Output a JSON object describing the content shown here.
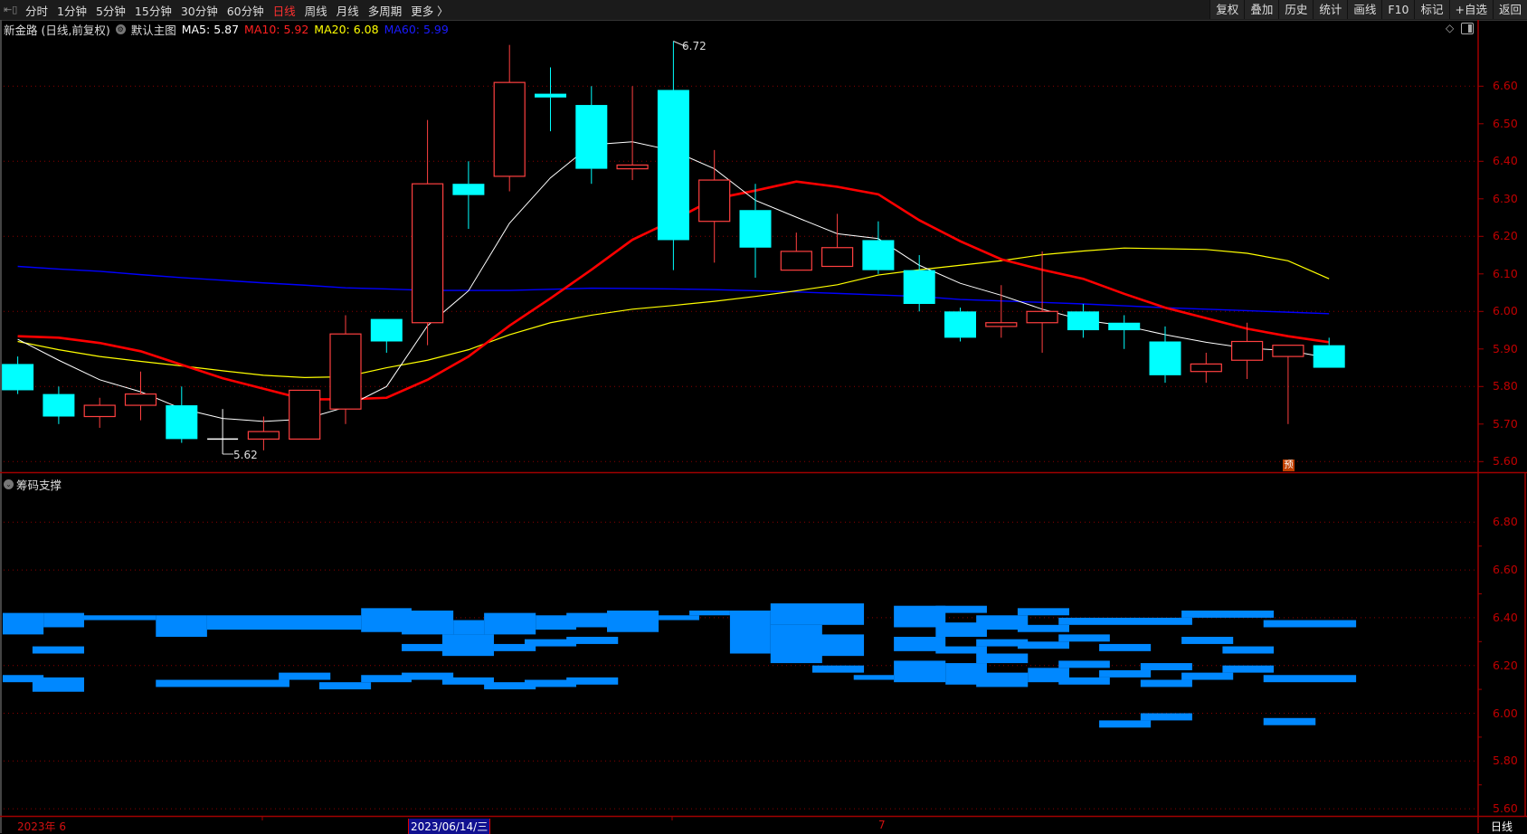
{
  "toolbar": {
    "periods": [
      "分时",
      "1分钟",
      "5分钟",
      "15分钟",
      "30分钟",
      "60分钟",
      "日线",
      "周线",
      "月线",
      "多周期",
      "更多 〉"
    ],
    "active_period": "日线",
    "buttons": [
      "复权",
      "叠加",
      "历史",
      "统计",
      "画线",
      "F10",
      "标记",
      "+自选",
      "返回"
    ]
  },
  "info": {
    "title": "新金路 (日线,前复权)",
    "template": "默认主图",
    "ma5": "MA5: 5.87",
    "ma10": "MA10: 5.92",
    "ma20": "MA20: 6.08",
    "ma60": "MA60: 5.99"
  },
  "colors": {
    "up": "#ff4040",
    "down": "#00ffff",
    "doji": "#ffffff",
    "ma5": "#ffffff",
    "ma10": "#ff0000",
    "ma20": "#ffff00",
    "ma60": "#0000ff",
    "chip": "#0088ff",
    "grid": "#8b0000"
  },
  "lower_panel": {
    "title": "筹码支撑"
  },
  "annotations": {
    "high": "6.72",
    "low": "5.62",
    "forecast_marker": "预"
  },
  "axis": {
    "main_ticks": [
      "6.60",
      "6.50",
      "6.40",
      "6.30",
      "6.20",
      "6.10",
      "6.00",
      "5.90",
      "5.80",
      "5.70",
      "5.60"
    ],
    "lower_ticks": [
      "6.80",
      "6.60",
      "6.40",
      "6.20",
      "6.00",
      "5.80",
      "5.60"
    ],
    "x_labels": {
      "start": "2023年 6",
      "cursor": "2023/06/14/三",
      "july": "7"
    },
    "period_label": "日线"
  },
  "chart_data": [
    {
      "type": "candlestick",
      "title": "新金路 (日线,前复权)",
      "ylim": [
        5.6,
        6.6
      ],
      "ohlc": [
        [
          5.86,
          5.88,
          5.78,
          5.79
        ],
        [
          5.78,
          5.8,
          5.7,
          5.72
        ],
        [
          5.72,
          5.77,
          5.69,
          5.75
        ],
        [
          5.75,
          5.84,
          5.71,
          5.78
        ],
        [
          5.75,
          5.8,
          5.65,
          5.66
        ],
        [
          5.66,
          5.74,
          5.62,
          5.66
        ],
        [
          5.66,
          5.72,
          5.63,
          5.68
        ],
        [
          5.66,
          5.79,
          5.66,
          5.79
        ],
        [
          5.74,
          5.99,
          5.7,
          5.94
        ],
        [
          5.98,
          5.98,
          5.89,
          5.92
        ],
        [
          5.97,
          6.51,
          5.91,
          6.34
        ],
        [
          6.34,
          6.4,
          6.22,
          6.31
        ],
        [
          6.36,
          6.71,
          6.32,
          6.61
        ],
        [
          6.58,
          6.65,
          6.48,
          6.57
        ],
        [
          6.55,
          6.6,
          6.34,
          6.38
        ],
        [
          6.38,
          6.6,
          6.35,
          6.39
        ],
        [
          6.59,
          6.72,
          6.11,
          6.19
        ],
        [
          6.24,
          6.43,
          6.13,
          6.35
        ],
        [
          6.27,
          6.34,
          6.09,
          6.17
        ],
        [
          6.11,
          6.21,
          6.11,
          6.16
        ],
        [
          6.12,
          6.26,
          6.12,
          6.17
        ],
        [
          6.19,
          6.24,
          6.1,
          6.11
        ],
        [
          6.11,
          6.15,
          6.0,
          6.02
        ],
        [
          6.0,
          6.01,
          5.92,
          5.93
        ],
        [
          5.96,
          6.07,
          5.93,
          5.97
        ],
        [
          5.97,
          6.16,
          5.89,
          6.0
        ],
        [
          6.0,
          6.02,
          5.93,
          5.95
        ],
        [
          5.97,
          5.99,
          5.9,
          5.95
        ],
        [
          5.92,
          5.96,
          5.81,
          5.83
        ],
        [
          5.84,
          5.89,
          5.81,
          5.86
        ],
        [
          5.87,
          5.97,
          5.82,
          5.92
        ],
        [
          5.88,
          5.91,
          5.7,
          5.91
        ],
        [
          5.91,
          5.93,
          5.85,
          5.85
        ]
      ],
      "series": [
        {
          "name": "MA5",
          "values": [
            5.926,
            5.87,
            5.818,
            5.786,
            5.741,
            5.715,
            5.707,
            5.713,
            5.745,
            5.8,
            5.962,
            6.055,
            6.235,
            6.356,
            6.444,
            6.452,
            6.428,
            6.38,
            6.296,
            6.251,
            6.207,
            6.194,
            6.123,
            6.075,
            6.043,
            6.006,
            5.977,
            5.962,
            5.938,
            5.918,
            5.902,
            5.896,
            5.876
          ]
        },
        {
          "name": "MA10",
          "values": [
            5.934,
            5.93,
            5.916,
            5.894,
            5.858,
            5.822,
            5.794,
            5.766,
            5.766,
            5.77,
            5.818,
            5.88,
            5.962,
            6.035,
            6.111,
            6.191,
            6.243,
            6.3,
            6.322,
            6.346,
            6.332,
            6.312,
            6.243,
            6.187,
            6.139,
            6.111,
            6.087,
            6.047,
            6.01,
            5.982,
            5.954,
            5.934,
            5.918
          ]
        },
        {
          "name": "MA20",
          "values": [
            5.92,
            5.898,
            5.88,
            5.867,
            5.855,
            5.842,
            5.83,
            5.824,
            5.826,
            5.85,
            5.87,
            5.898,
            5.938,
            5.97,
            5.99,
            6.006,
            6.016,
            6.027,
            6.04,
            6.055,
            6.071,
            6.097,
            6.111,
            6.123,
            6.135,
            6.151,
            6.161,
            6.169,
            6.167,
            6.165,
            6.155,
            6.135,
            6.087
          ]
        },
        {
          "name": "MA60",
          "values": [
            6.12,
            6.113,
            6.107,
            6.098,
            6.09,
            6.083,
            6.076,
            6.07,
            6.063,
            6.06,
            6.056,
            6.056,
            6.056,
            6.059,
            6.062,
            6.061,
            6.06,
            6.058,
            6.055,
            6.052,
            6.048,
            6.044,
            6.04,
            6.032,
            6.028,
            6.024,
            6.02,
            6.015,
            6.01,
            6.006,
            6.002,
            5.998,
            5.994
          ]
        }
      ]
    },
    {
      "type": "chip_distribution",
      "title": "筹码支撑",
      "ylim": [
        5.6,
        6.8
      ],
      "bars_note": "each bar: [from candle index, to candle index, price top, price bottom]",
      "bars": [
        [
          -0.4,
          0.63,
          6.42,
          6.33
        ],
        [
          0.63,
          1.62,
          6.42,
          6.36
        ],
        [
          1.62,
          3.37,
          6.41,
          6.39
        ],
        [
          3.37,
          4.62,
          6.41,
          6.32
        ],
        [
          4.62,
          8.38,
          6.41,
          6.35
        ],
        [
          8.38,
          9.61,
          6.44,
          6.34
        ],
        [
          9.37,
          10.63,
          6.43,
          6.33
        ],
        [
          10.63,
          11.38,
          6.39,
          6.33
        ],
        [
          11.38,
          12.64,
          6.42,
          6.33
        ],
        [
          12.64,
          13.63,
          6.41,
          6.35
        ],
        [
          13.39,
          14.38,
          6.42,
          6.36
        ],
        [
          14.38,
          15.64,
          6.43,
          6.34
        ],
        [
          0.36,
          1.62,
          6.28,
          6.25
        ],
        [
          9.37,
          10.63,
          6.29,
          6.26
        ],
        [
          10.36,
          11.62,
          6.33,
          6.24
        ],
        [
          11.62,
          12.64,
          6.29,
          6.26
        ],
        [
          12.37,
          13.63,
          6.31,
          6.28
        ],
        [
          13.39,
          14.65,
          6.32,
          6.29
        ],
        [
          -0.4,
          0.63,
          6.16,
          6.13
        ],
        [
          0.36,
          1.62,
          6.15,
          6.09
        ],
        [
          3.37,
          6.63,
          6.14,
          6.11
        ],
        [
          6.37,
          7.63,
          6.17,
          6.14
        ],
        [
          7.36,
          8.62,
          6.13,
          6.1
        ],
        [
          8.38,
          9.61,
          6.16,
          6.13
        ],
        [
          9.37,
          10.63,
          6.17,
          6.14
        ],
        [
          10.36,
          11.62,
          6.15,
          6.12
        ],
        [
          11.38,
          12.64,
          6.13,
          6.1
        ],
        [
          12.37,
          13.63,
          6.14,
          6.11
        ],
        [
          13.39,
          14.65,
          6.15,
          6.12
        ],
        [
          15.64,
          16.63,
          6.41,
          6.39
        ],
        [
          16.39,
          17.38,
          6.43,
          6.41
        ],
        [
          17.38,
          18.37,
          6.43,
          6.25
        ],
        [
          18.37,
          20.65,
          6.46,
          6.37
        ],
        [
          18.37,
          19.63,
          6.37,
          6.21
        ],
        [
          18.64,
          20.65,
          6.33,
          6.24
        ],
        [
          19.39,
          20.65,
          6.2,
          6.17
        ],
        [
          20.4,
          21.38,
          6.16,
          6.14
        ],
        [
          21.38,
          22.64,
          6.45,
          6.36
        ],
        [
          21.38,
          22.64,
          6.32,
          6.26
        ],
        [
          21.38,
          22.64,
          6.22,
          6.13
        ],
        [
          22.4,
          23.65,
          6.45,
          6.42
        ],
        [
          22.4,
          23.65,
          6.38,
          6.32
        ],
        [
          22.4,
          23.65,
          6.28,
          6.25
        ],
        [
          22.64,
          23.65,
          6.21,
          6.12
        ],
        [
          23.39,
          24.65,
          6.41,
          6.35
        ],
        [
          23.39,
          24.65,
          6.31,
          6.28
        ],
        [
          23.39,
          24.65,
          6.25,
          6.21
        ],
        [
          23.39,
          24.65,
          6.17,
          6.11
        ],
        [
          24.4,
          25.66,
          6.44,
          6.41
        ],
        [
          24.4,
          25.66,
          6.37,
          6.34
        ],
        [
          24.4,
          25.66,
          6.3,
          6.27
        ],
        [
          24.65,
          25.66,
          6.19,
          6.13
        ],
        [
          25.4,
          28.66,
          6.4,
          6.37
        ],
        [
          25.4,
          26.65,
          6.33,
          6.3
        ],
        [
          25.4,
          26.65,
          6.22,
          6.19
        ],
        [
          25.4,
          26.65,
          6.15,
          6.12
        ],
        [
          26.39,
          27.65,
          6.29,
          6.26
        ],
        [
          26.39,
          27.65,
          6.18,
          6.15
        ],
        [
          26.39,
          27.65,
          5.97,
          5.94
        ],
        [
          27.4,
          28.66,
          6.21,
          6.18
        ],
        [
          27.4,
          28.66,
          6.14,
          6.11
        ],
        [
          27.4,
          28.66,
          6.0,
          5.97
        ],
        [
          28.4,
          30.65,
          6.43,
          6.4
        ],
        [
          28.4,
          29.66,
          6.32,
          6.29
        ],
        [
          28.4,
          29.66,
          6.17,
          6.14
        ],
        [
          29.4,
          30.65,
          6.28,
          6.25
        ],
        [
          29.4,
          30.65,
          6.2,
          6.17
        ],
        [
          30.4,
          32.66,
          6.39,
          6.36
        ],
        [
          30.4,
          32.66,
          6.16,
          6.13
        ],
        [
          30.4,
          31.67,
          5.98,
          5.95
        ]
      ]
    }
  ]
}
